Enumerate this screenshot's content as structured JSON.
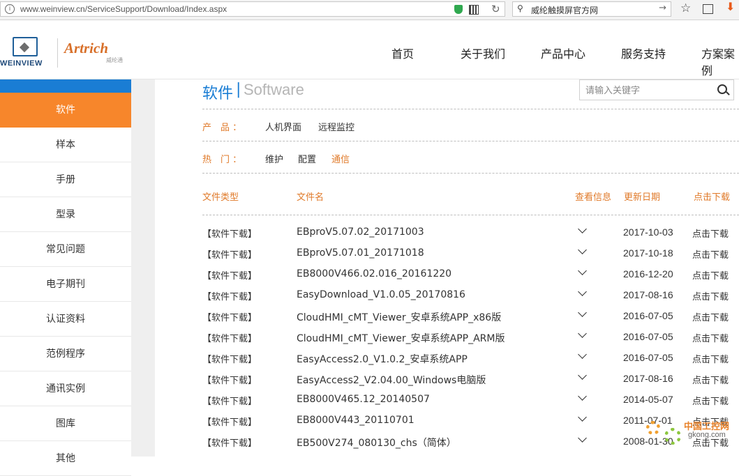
{
  "browser": {
    "url": "www.weinview.cn/ServiceSupport/Download/Index.aspx",
    "search_value": "威纶触摸屏官方网"
  },
  "site": {
    "logo_text": "WEINVIEW",
    "brand2": "Artrich",
    "brand2_sub": "威纶通",
    "nav": [
      "首页",
      "关于我们",
      "产品中心",
      "服务支持",
      "方案案例"
    ]
  },
  "sidebar": {
    "items": [
      {
        "label": "软件",
        "active": true
      },
      {
        "label": "样本"
      },
      {
        "label": "手册"
      },
      {
        "label": "型录"
      },
      {
        "label": "常见问题"
      },
      {
        "label": "电子期刊"
      },
      {
        "label": "认证资料"
      },
      {
        "label": "范例程序"
      },
      {
        "label": "通讯实例"
      },
      {
        "label": "图库"
      },
      {
        "label": "其他"
      }
    ]
  },
  "main": {
    "title_cn": "软件",
    "title_sep": "|",
    "title_en": "Software",
    "keyword_placeholder": "请输入关键字",
    "filters": {
      "product_label": "产　品 ：",
      "product_options": [
        "人机界面",
        "远程监控"
      ],
      "hot_label": "热　门 ：",
      "hot_options": [
        "维护",
        "配置",
        "通信"
      ],
      "hot_selected": "通信"
    },
    "columns": {
      "type": "文件类型",
      "name": "文件名",
      "info": "查看信息",
      "date": "更新日期",
      "download": "点击下载"
    },
    "rows": [
      {
        "type": "【软件下载】",
        "name": "EBproV5.07.02_20171003",
        "date": "2017-10-03",
        "download": "点击下载"
      },
      {
        "type": "【软件下载】",
        "name": "EBproV5.07.01_20171018",
        "date": "2017-10-18",
        "download": "点击下载"
      },
      {
        "type": "【软件下载】",
        "name": "EB8000V466.02.016_20161220",
        "date": "2016-12-20",
        "download": "点击下载"
      },
      {
        "type": "【软件下载】",
        "name": "EasyDownload_V1.0.05_20170816",
        "date": "2017-08-16",
        "download": "点击下载"
      },
      {
        "type": "【软件下载】",
        "name": "CloudHMI_cMT_Viewer_安卓系统APP_x86版",
        "date": "2016-07-05",
        "download": "点击下载"
      },
      {
        "type": "【软件下载】",
        "name": "CloudHMI_cMT_Viewer_安卓系统APP_ARM版",
        "date": "2016-07-05",
        "download": "点击下载"
      },
      {
        "type": "【软件下载】",
        "name": "EasyAccess2.0_V1.0.2_安卓系统APP",
        "date": "2016-07-05",
        "download": "点击下载"
      },
      {
        "type": "【软件下载】",
        "name": "EasyAccess2_V2.04.00_Windows电脑版",
        "date": "2017-08-16",
        "download": "点击下载"
      },
      {
        "type": "【软件下载】",
        "name": "EB8000V465.12_20140507",
        "date": "2014-05-07",
        "download": "点击下载"
      },
      {
        "type": "【软件下载】",
        "name": "EB8000V443_20110701",
        "date": "2011-07-01",
        "download": "点击下载"
      },
      {
        "type": "【软件下载】",
        "name": "EB500V274_080130_chs（简体）",
        "date": "2008-01-30",
        "download": "点击下载"
      }
    ]
  },
  "watermark": {
    "text": "中国工控网",
    "url": "gkong.com"
  },
  "colors": {
    "accent_blue": "#1a7dd4",
    "accent_orange": "#f7862b",
    "label_orange": "#e07a2a"
  }
}
